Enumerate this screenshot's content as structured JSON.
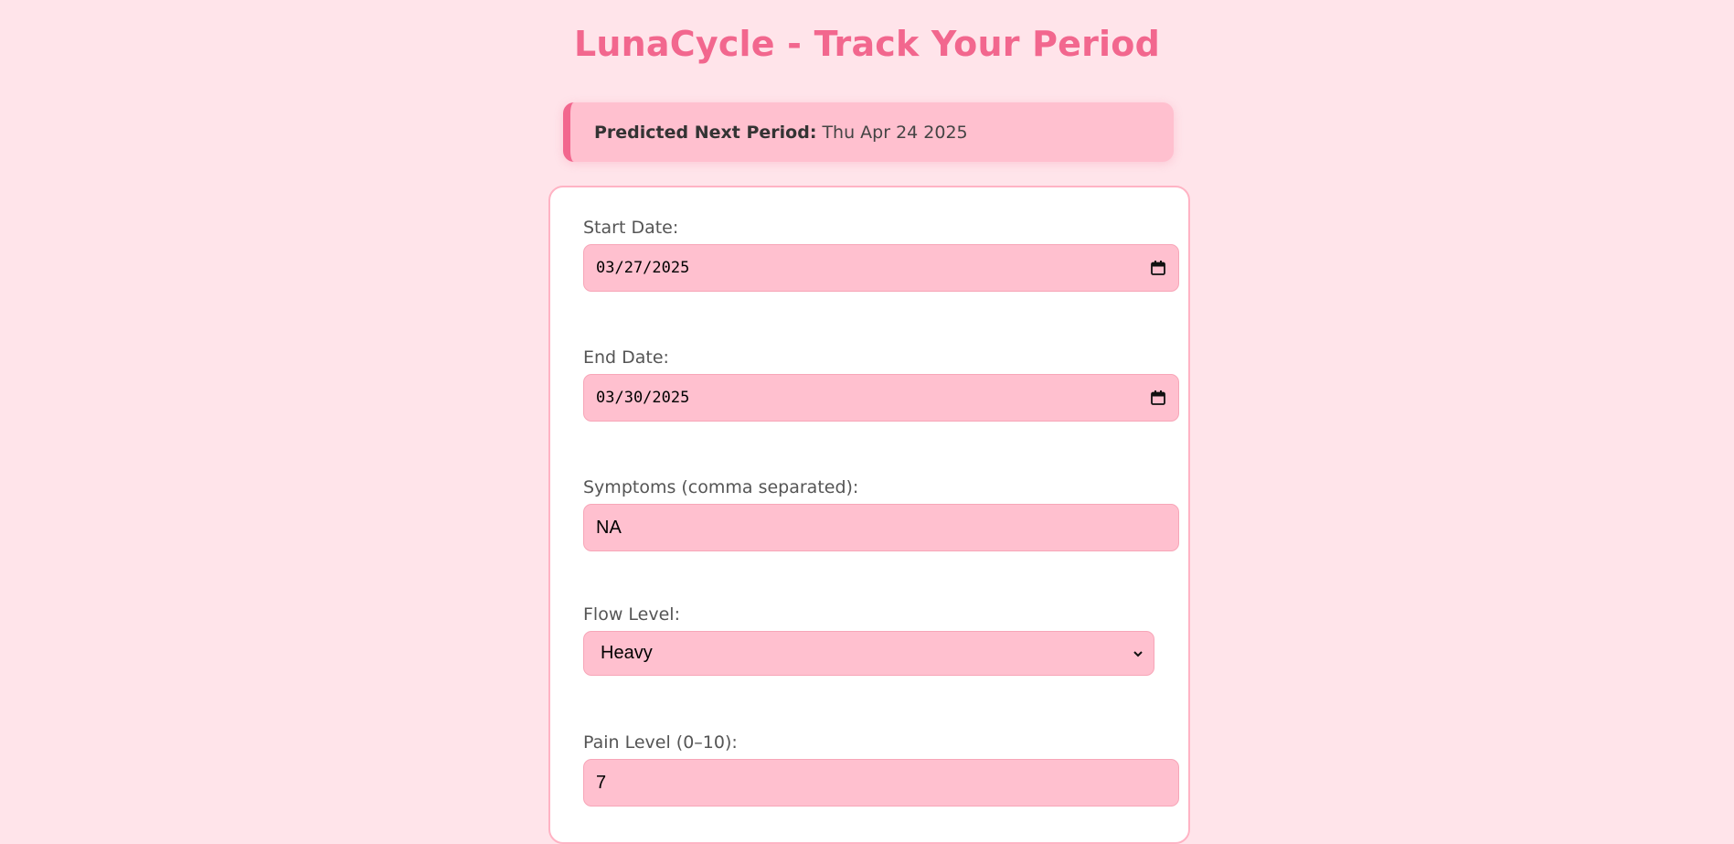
{
  "title": "LunaCycle - Track Your Period",
  "prediction": {
    "label": "Predicted Next Period:",
    "value": "Thu Apr 24 2025"
  },
  "form": {
    "start_date": {
      "label": "Start Date:",
      "value": "03/27/2025"
    },
    "end_date": {
      "label": "End Date:",
      "value": "03/30/2025"
    },
    "symptoms": {
      "label": "Symptoms (comma separated):",
      "value": "NA"
    },
    "flow": {
      "label": "Flow Level:",
      "value": "Heavy"
    },
    "pain": {
      "label": "Pain Level (0–10):",
      "value": "7"
    }
  },
  "colors": {
    "background": "#ffe4ea",
    "accent": "#f2678e",
    "field_bg": "#ffc0cf"
  },
  "icons": {
    "calendar": "calendar-icon",
    "dropdown": "chevron-down-icon"
  }
}
